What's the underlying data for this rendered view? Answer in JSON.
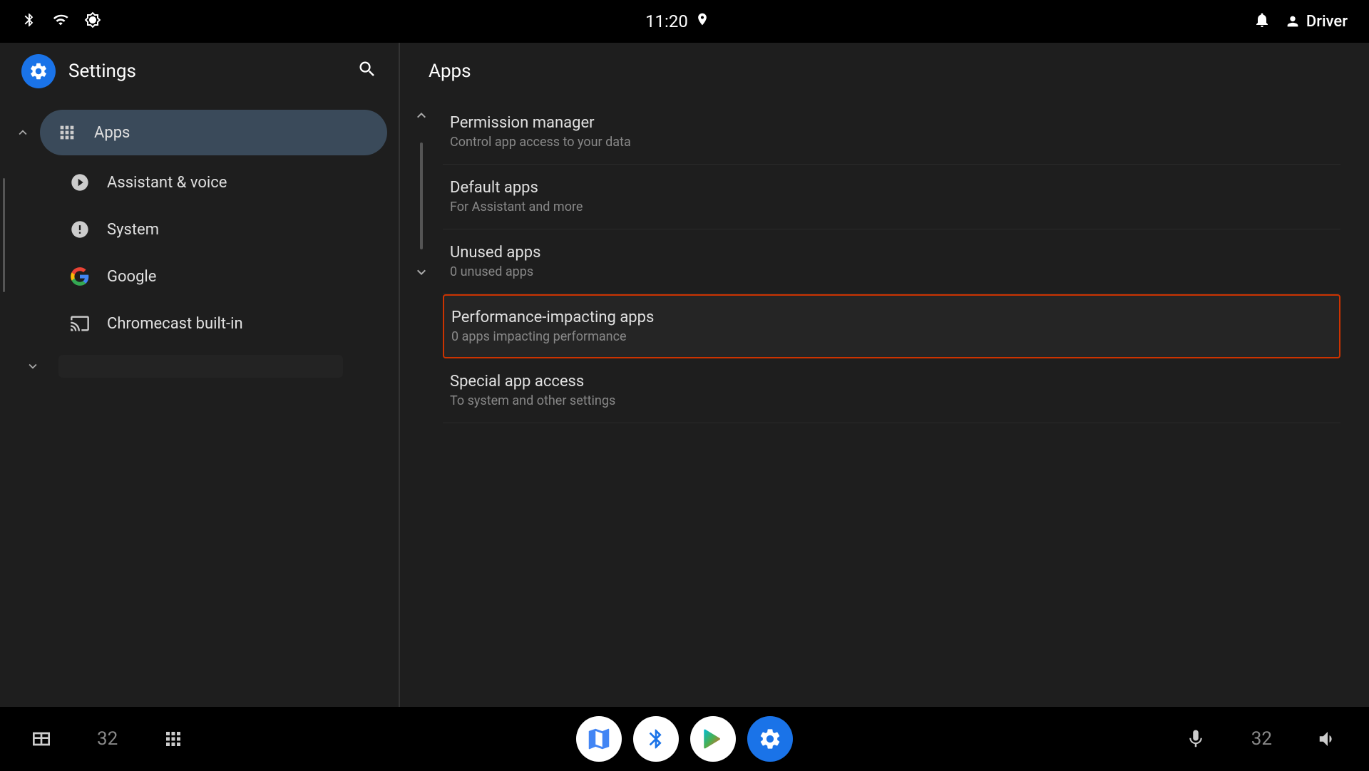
{
  "statusBar": {
    "time": "11:20",
    "icons": {
      "bluetooth": "bluetooth",
      "wifi": "wifi",
      "brightness": "brightness",
      "location": "location",
      "bell": "bell",
      "user": "user"
    },
    "userLabel": "Driver"
  },
  "leftPanel": {
    "title": "Settings",
    "searchLabel": "search",
    "nav": {
      "appsItem": {
        "label": "Apps",
        "icon": "grid"
      },
      "items": [
        {
          "label": "Assistant & voice",
          "icon": "assistant"
        },
        {
          "label": "System",
          "icon": "info-circle"
        },
        {
          "label": "Google",
          "icon": "google"
        },
        {
          "label": "Chromecast built-in",
          "icon": "cast"
        }
      ]
    },
    "topChevronLabel": "collapse",
    "bottomChevronLabel": "expand"
  },
  "rightPanel": {
    "title": "Apps",
    "items": [
      {
        "title": "Permission manager",
        "subtitle": "Control app access to your data",
        "selected": false
      },
      {
        "title": "Default apps",
        "subtitle": "For Assistant and more",
        "selected": false
      },
      {
        "title": "Unused apps",
        "subtitle": "0 unused apps",
        "selected": false
      },
      {
        "title": "Performance-impacting apps",
        "subtitle": "0 apps impacting performance",
        "selected": true
      },
      {
        "title": "Special app access",
        "subtitle": "To system and other settings",
        "selected": false
      }
    ]
  },
  "taskbar": {
    "leftNum": "32",
    "rightNum": "32",
    "apps": [
      {
        "name": "maps",
        "label": "Maps"
      },
      {
        "name": "bluetooth",
        "label": "Bluetooth"
      },
      {
        "name": "play",
        "label": "Play Store"
      },
      {
        "name": "settings",
        "label": "Settings"
      }
    ]
  }
}
